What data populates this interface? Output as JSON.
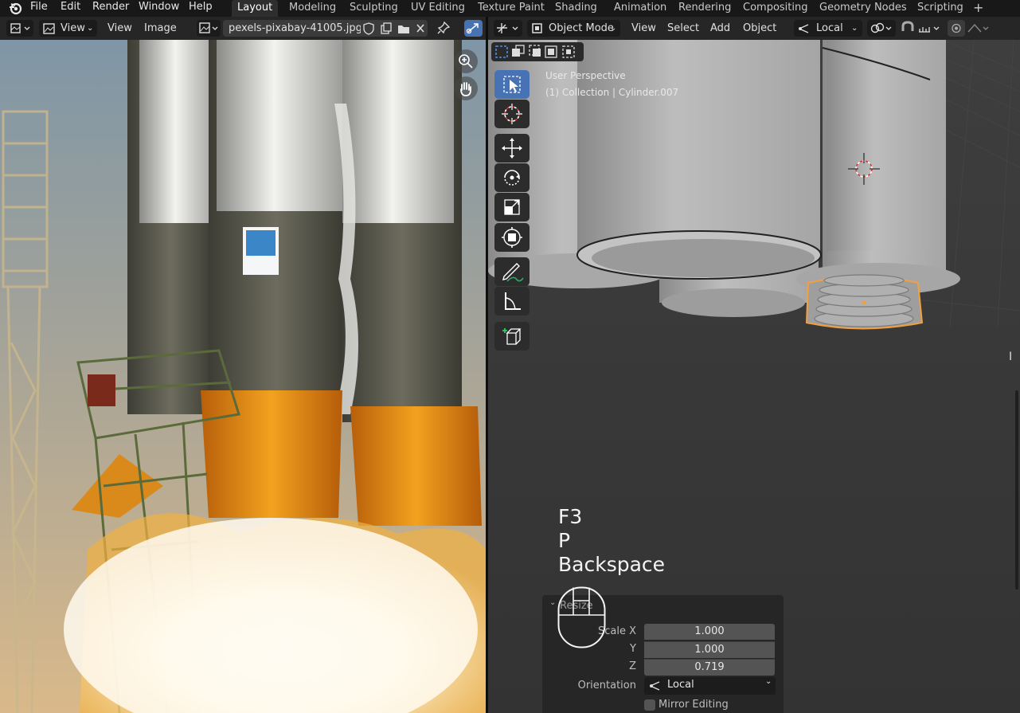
{
  "menu": [
    "File",
    "Edit",
    "Render",
    "Window",
    "Help"
  ],
  "workspaces": [
    "Layout",
    "Modeling",
    "Sculpting",
    "UV Editing",
    "Texture Paint",
    "Shading",
    "Animation",
    "Rendering",
    "Compositing",
    "Geometry Nodes",
    "Scripting",
    "+"
  ],
  "image_editor": {
    "view_mode_label": "View",
    "menu": [
      "View",
      "Image"
    ],
    "image_name": "pexels-pixabay-41005.jpg"
  },
  "viewport": {
    "mode": "Object Mode",
    "menu": [
      "View",
      "Select",
      "Add",
      "Object"
    ],
    "transform_orientation": "Local",
    "overlay_line1": "User Perspective",
    "overlay_line2": "(1) Collection | Cylinder.007"
  },
  "keys": [
    "F3",
    "P",
    "Backspace"
  ],
  "operator_panel": {
    "title": "Resize",
    "scale_x_label": "Scale X",
    "scale_x": "1.000",
    "y_label": "Y",
    "y": "1.000",
    "z_label": "Z",
    "z": "0.719",
    "orientation_label": "Orientation",
    "orientation_value": "Local",
    "mirror_label": "Mirror Editing"
  },
  "colors": {
    "accent": "#4772b3",
    "selection_outline": "#f29f3d",
    "rocket_orange": "#e8961a",
    "rocket_grey": "#5e5d50"
  }
}
